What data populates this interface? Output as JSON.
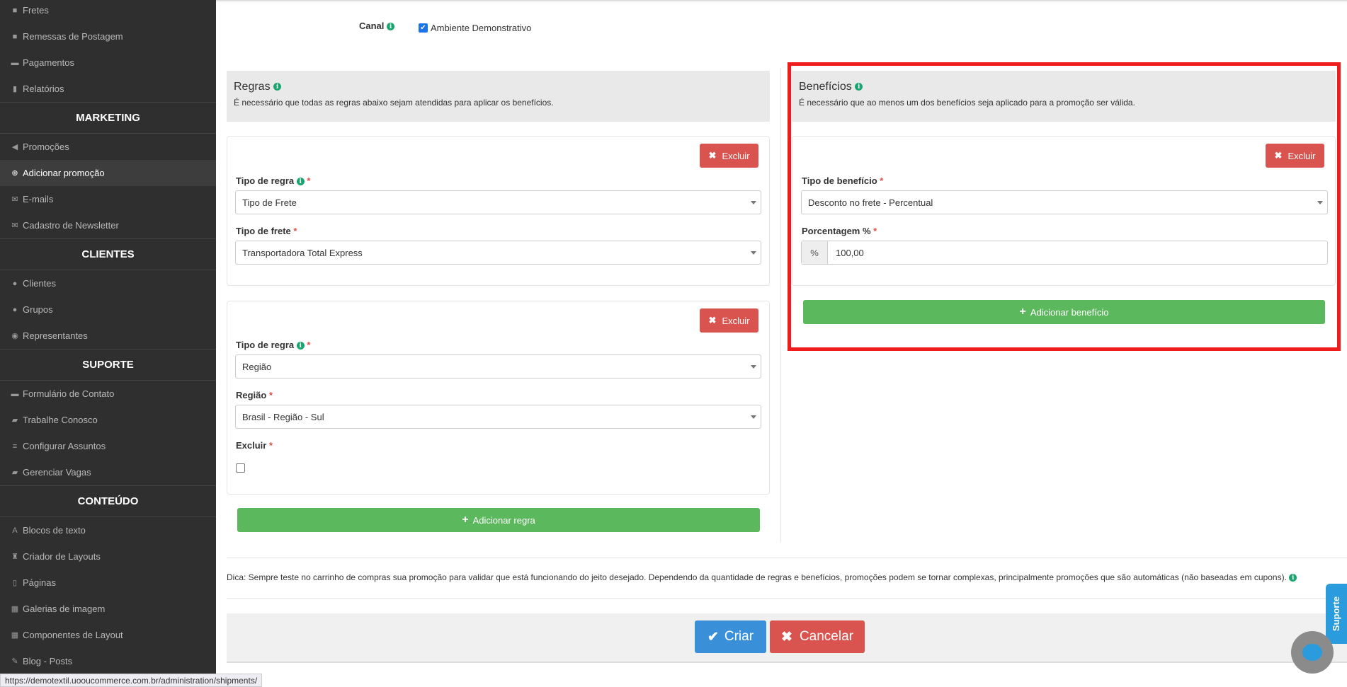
{
  "sidebar": {
    "items_a": [
      {
        "label": "Fretes",
        "icon": "truck-icon",
        "glyph": "■"
      },
      {
        "label": "Remessas de Postagem",
        "icon": "truck-icon",
        "glyph": "■"
      },
      {
        "label": "Pagamentos",
        "icon": "credit-card-icon",
        "glyph": "▬"
      },
      {
        "label": "Relatórios",
        "icon": "bar-chart-icon",
        "glyph": "▮"
      }
    ],
    "section_marketing": "MARKETING",
    "items_marketing": [
      {
        "label": "Promoções",
        "icon": "bullhorn-icon",
        "glyph": "◀"
      },
      {
        "label": "Adicionar promoção",
        "icon": "plus-circle-icon",
        "glyph": "⊕"
      },
      {
        "label": "E-mails",
        "icon": "envelope-icon",
        "glyph": "✉"
      },
      {
        "label": "Cadastro de Newsletter",
        "icon": "envelope-icon",
        "glyph": "✉"
      }
    ],
    "section_clientes": "CLIENTES",
    "items_clientes": [
      {
        "label": "Clientes",
        "icon": "user-icon",
        "glyph": "●"
      },
      {
        "label": "Grupos",
        "icon": "users-icon",
        "glyph": "●"
      },
      {
        "label": "Representantes",
        "icon": "user-circle-icon",
        "glyph": "◉"
      }
    ],
    "section_suporte": "SUPORTE",
    "items_suporte": [
      {
        "label": "Formulário de Contato",
        "icon": "comment-icon",
        "glyph": "▬"
      },
      {
        "label": "Trabalhe Conosco",
        "icon": "briefcase-icon",
        "glyph": "▰"
      },
      {
        "label": "Configurar Assuntos",
        "icon": "list-icon",
        "glyph": "≡"
      },
      {
        "label": "Gerenciar Vagas",
        "icon": "briefcase-icon",
        "glyph": "▰"
      }
    ],
    "section_conteudo": "CONTEÚDO",
    "items_conteudo": [
      {
        "label": "Blocos de texto",
        "icon": "font-icon",
        "glyph": "A"
      },
      {
        "label": "Criador de Layouts",
        "icon": "chess-rook-icon",
        "glyph": "♜"
      },
      {
        "label": "Páginas",
        "icon": "file-icon",
        "glyph": "▯"
      },
      {
        "label": "Galerias de imagem",
        "icon": "film-icon",
        "glyph": "▦"
      },
      {
        "label": "Componentes de Layout",
        "icon": "th-large-icon",
        "glyph": "▦"
      },
      {
        "label": "Blog - Posts",
        "icon": "pencil-icon",
        "glyph": "✎"
      }
    ]
  },
  "canal": {
    "label": "Canal",
    "checkbox_label": "Ambiente Demonstrativo",
    "checked": true
  },
  "regras": {
    "title": "Regras",
    "subtitle": "É necessário que todas as regras abaixo sejam atendidas para aplicar os benefícios.",
    "delete_label": "Excluir",
    "rule1": {
      "tipo_label": "Tipo de regra",
      "tipo_value": "Tipo de Frete",
      "second_label": "Tipo de frete",
      "second_value": "Transportadora Total Express"
    },
    "rule2": {
      "tipo_label": "Tipo de regra",
      "tipo_value": "Região",
      "second_label": "Região",
      "second_value": "Brasil - Região - Sul",
      "excluir_label": "Excluir"
    },
    "add_label": "Adicionar regra"
  },
  "beneficios": {
    "title": "Benefícios",
    "subtitle": "É necessário que ao menos um dos benefícios seja aplicado para a promoção ser válida.",
    "delete_label": "Excluir",
    "tipo_label": "Tipo de benefício",
    "tipo_value": "Desconto no frete - Percentual",
    "pct_label": "Porcentagem %",
    "pct_addon": "%",
    "pct_value": "100,00",
    "add_label": "Adicionar benefício"
  },
  "required_mark": "*",
  "dica": "Dica: Sempre teste no carrinho de compras sua promoção para validar que está funcionando do jeito desejado. Dependendo da quantidade de regras e benefícios, promoções podem se tornar complexas, principalmente promoções que são automáticas (não baseadas em cupons).",
  "actions": {
    "create": "Criar",
    "cancel": "Cancelar"
  },
  "status_url": "https://demotextil.uooucommerce.com.br/administration/shipments/",
  "suporte_tab": "Suporte",
  "colors": {
    "sidebar": "#2f2f2f",
    "danger": "#d9534f",
    "success": "#5cb85c",
    "primary": "#3a8fd9",
    "highlight": "#ee1c1c"
  }
}
